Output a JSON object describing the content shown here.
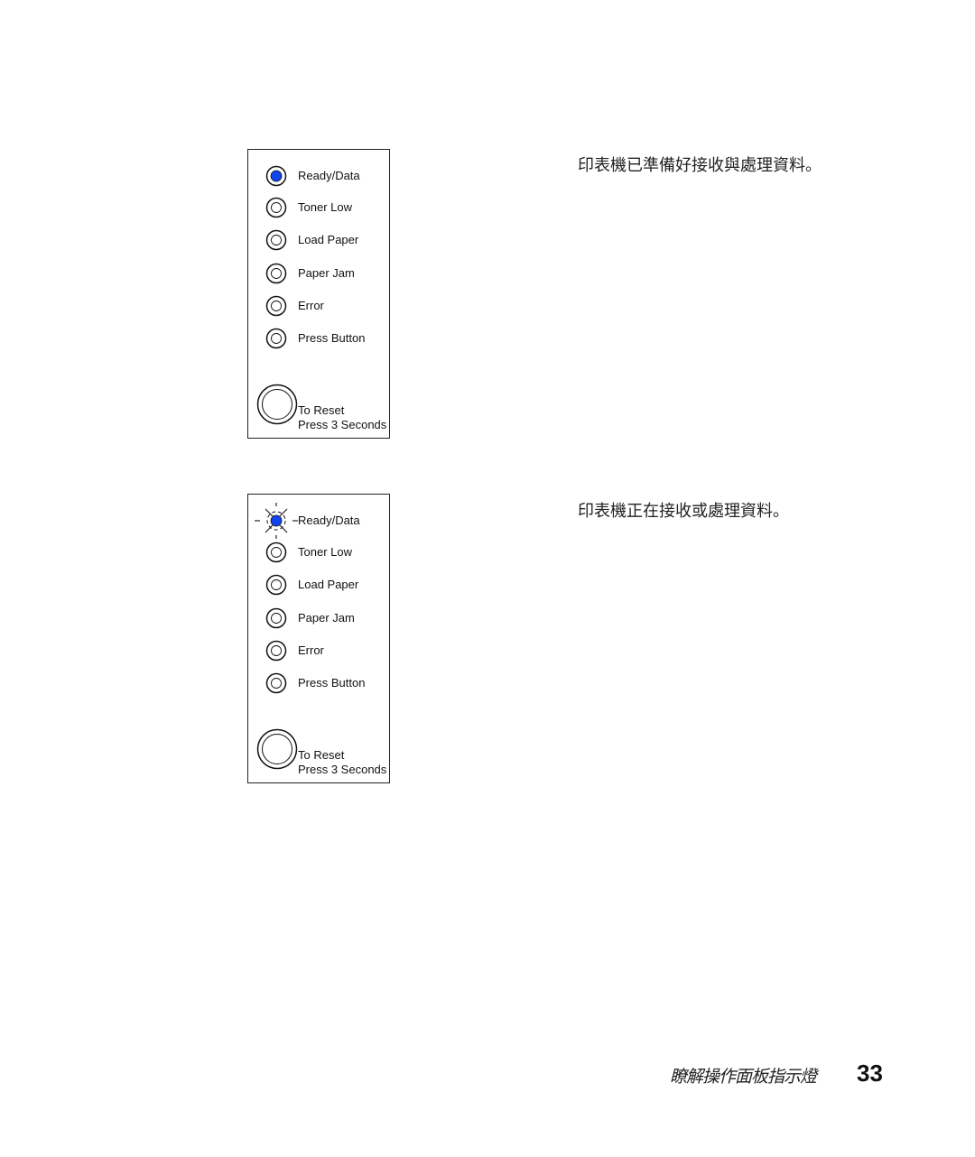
{
  "panels": [
    {
      "indicators": [
        {
          "label": "Ready/Data",
          "state": "on"
        },
        {
          "label": "Toner Low",
          "state": "off"
        },
        {
          "label": "Load Paper",
          "state": "off"
        },
        {
          "label": "Paper Jam",
          "state": "off"
        },
        {
          "label": "Error",
          "state": "off"
        },
        {
          "label": "Press Button",
          "state": "off"
        }
      ],
      "reset_line1": "To Reset",
      "reset_line2": "Press 3 Seconds",
      "description": "印表機已準備好接收與處理資料。"
    },
    {
      "indicators": [
        {
          "label": "Ready/Data",
          "state": "blinking"
        },
        {
          "label": "Toner Low",
          "state": "off"
        },
        {
          "label": "Load Paper",
          "state": "off"
        },
        {
          "label": "Paper Jam",
          "state": "off"
        },
        {
          "label": "Error",
          "state": "off"
        },
        {
          "label": "Press Button",
          "state": "off"
        }
      ],
      "reset_line1": "To Reset",
      "reset_line2": "Press 3 Seconds",
      "description": "印表機正在接收或處理資料。"
    }
  ],
  "colors": {
    "led_on": "#1144ee"
  },
  "footer": {
    "section_title": "瞭解操作面板指示燈",
    "page_number": "33"
  }
}
